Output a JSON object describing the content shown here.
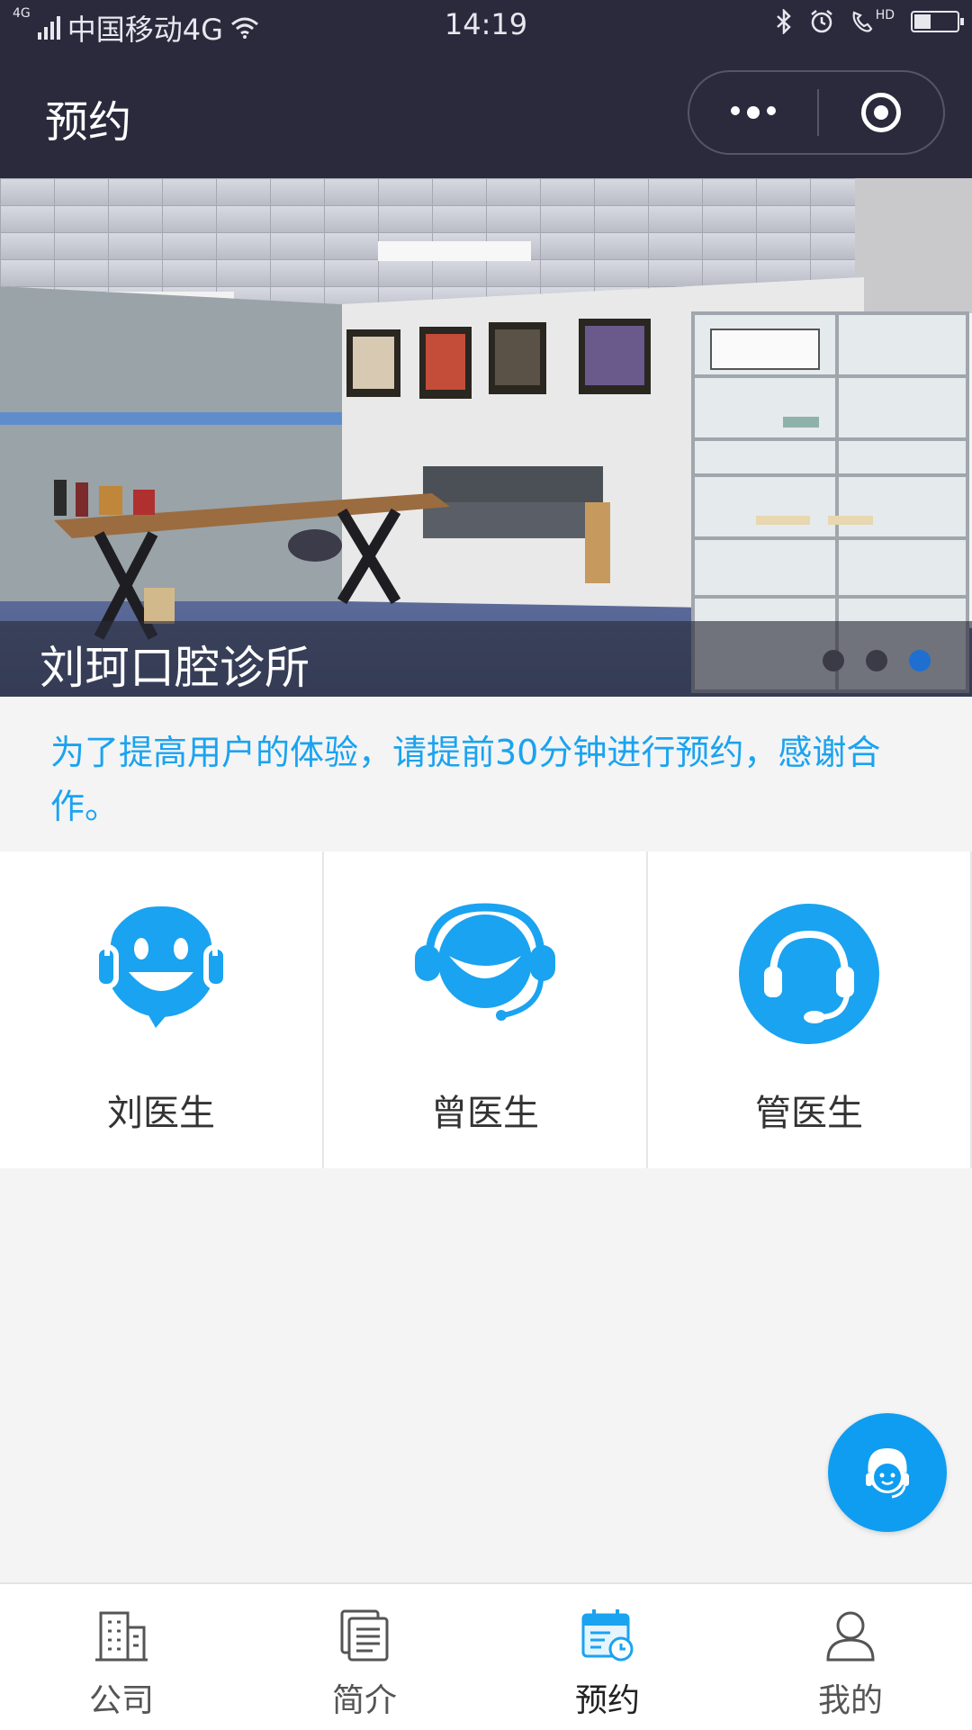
{
  "status_bar": {
    "network_tag": "4G",
    "carrier": "中国移动4G",
    "time": "14:19",
    "hd_tag": "HD"
  },
  "nav": {
    "title": "预约"
  },
  "banner": {
    "caption": "刘珂口腔诊所",
    "slide_count": 3,
    "active_slide": 3
  },
  "notice": {
    "text": "为了提高用户的体验，请提前30分钟进行预约，感谢合作。"
  },
  "doctors": [
    {
      "name": "刘医生",
      "icon": "smiling-headset-face-icon"
    },
    {
      "name": "曾医生",
      "icon": "smiling-headset-face-icon"
    },
    {
      "name": "管医生",
      "icon": "headset-icon"
    }
  ],
  "tabbar": {
    "items": [
      {
        "label": "公司",
        "icon": "building-icon",
        "active": false
      },
      {
        "label": "简介",
        "icon": "document-icon",
        "active": false
      },
      {
        "label": "预约",
        "icon": "calendar-clock-icon",
        "active": true
      },
      {
        "label": "我的",
        "icon": "user-icon",
        "active": false
      }
    ]
  },
  "colors": {
    "nav_bg": "#2b2a3d",
    "accent": "#1aa3f0",
    "fab": "#0f9df1",
    "tab_active": "#1aa3f0"
  }
}
